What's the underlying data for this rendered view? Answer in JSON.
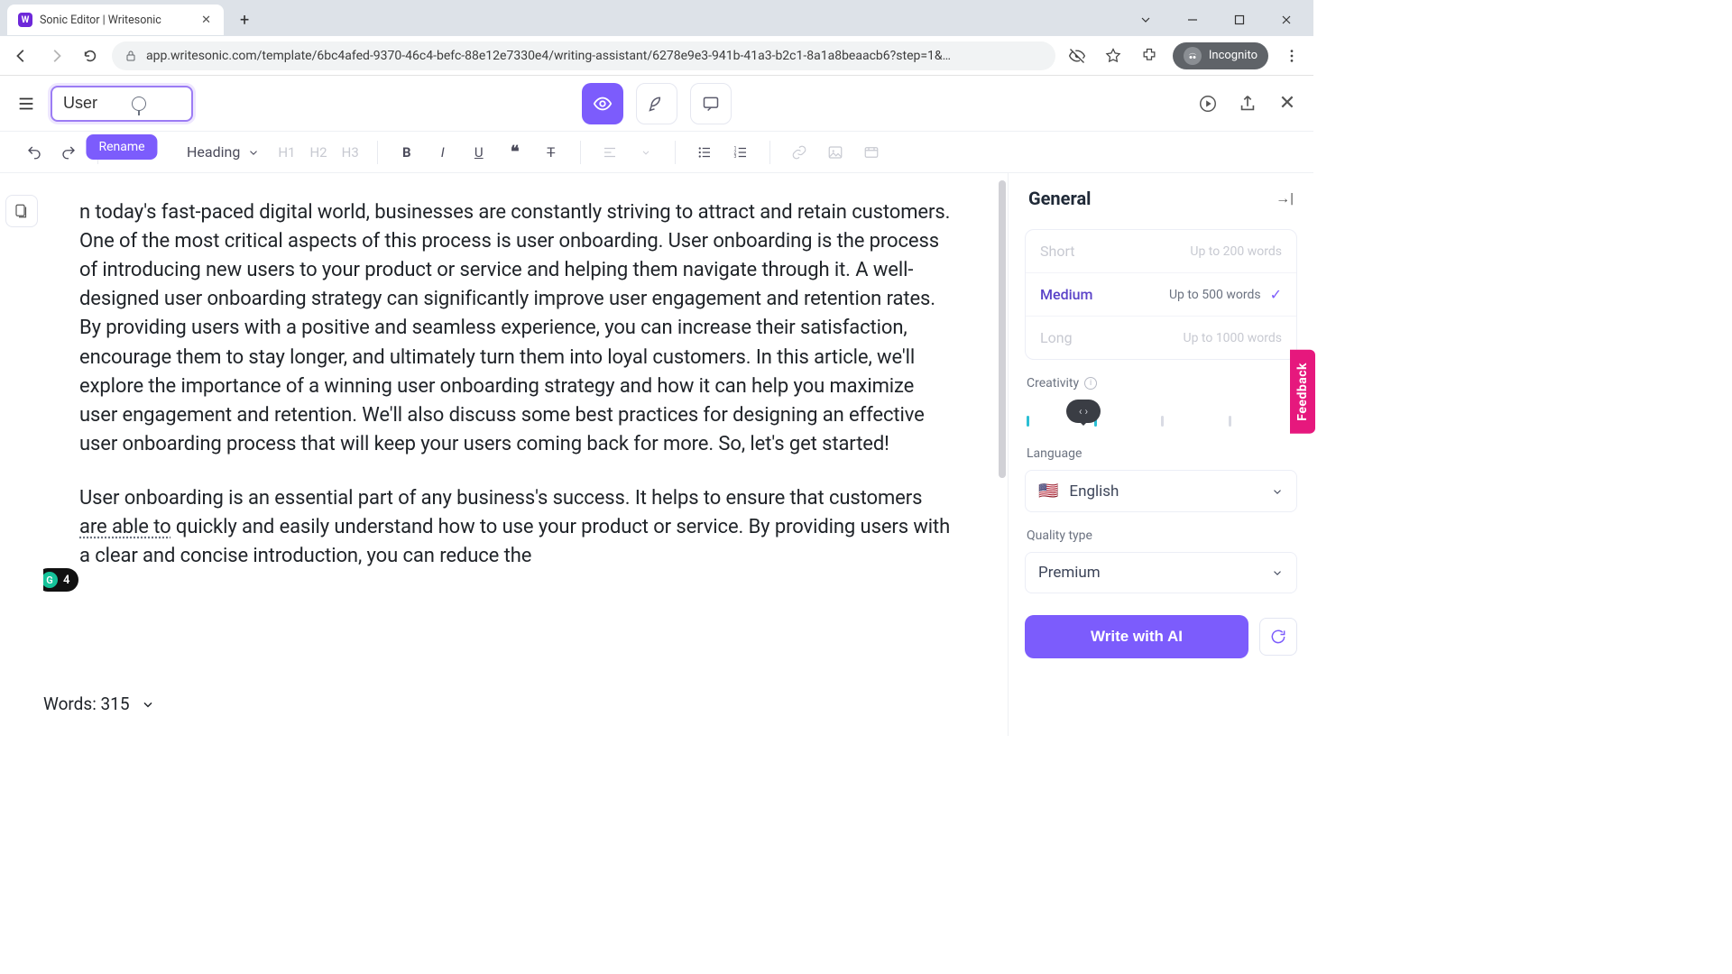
{
  "browser": {
    "tab_title": "Sonic Editor | Writesonic",
    "url": "app.writesonic.com/template/6bc4afed-9370-46c4-befc-88e12e7330e4/writing-assistant/6278e9e3-941b-41a3-b2c1-8a1a8beaacb6?step=1&…",
    "incognito_label": "Incognito"
  },
  "header": {
    "doc_title_value": "User ",
    "rename_tooltip": "Rename"
  },
  "toolbar": {
    "heading_label": "Heading",
    "h1": "H1",
    "h2": "H2",
    "h3": "H3"
  },
  "document": {
    "para1": "n today's fast-paced digital world, businesses are constantly striving to attract and retain customers. One of the most critical aspects of this process is user onboarding. User onboarding is the process of introducing new users to your product or service and helping them navigate through it. A well-designed user onboarding strategy can significantly improve user engagement and retention rates. By providing users with a positive and seamless experience, you can increase their satisfaction, encourage them to stay longer, and ultimately turn them into loyal customers. In this article, we'll explore the importance of a winning user onboarding strategy and how it can help you maximize user engagement and retention. We'll also discuss some best practices for designing an effective user onboarding process that will keep your users coming back for more. So, let's get started!",
    "para2_pre": "User onboarding is an essential part of any business's success. It helps to ensure that customers ",
    "para2_dotted": "are able to",
    "para2_post": " quickly and easily understand how to use your product or service. By providing users with a clear and concise introduction, you can reduce the",
    "grammarly_count": "4",
    "words_label": "Words: 315"
  },
  "sidebar": {
    "title": "General",
    "length": {
      "short": {
        "label": "Short",
        "hint": "Up to 200 words"
      },
      "medium": {
        "label": "Medium",
        "hint": "Up to 500 words"
      },
      "long": {
        "label": "Long",
        "hint": "Up to 1000 words"
      }
    },
    "creativity_label": "Creativity",
    "language_label": "Language",
    "language_value": "English",
    "quality_label": "Quality type",
    "quality_value": "Premium",
    "write_label": "Write with AI",
    "feedback_label": "Feedback"
  }
}
